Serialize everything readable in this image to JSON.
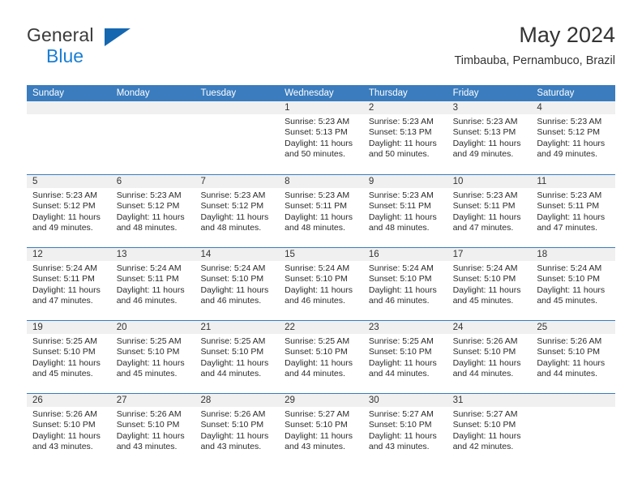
{
  "brand": {
    "name_part1": "General",
    "name_part2": "Blue",
    "triangle_color": "#1567b0",
    "blue_color": "#1a7fd4"
  },
  "header": {
    "title": "May 2024",
    "subtitle": "Timbauba, Pernambuco, Brazil"
  },
  "calendar": {
    "header_bg": "#3a7cbe",
    "daynum_bg": "#f0f0f0",
    "weekday_headers": [
      "Sunday",
      "Monday",
      "Tuesday",
      "Wednesday",
      "Thursday",
      "Friday",
      "Saturday"
    ],
    "weeks": [
      [
        {
          "day": "",
          "sunrise": "",
          "sunset": "",
          "daylight_line1": "",
          "daylight_line2": ""
        },
        {
          "day": "",
          "sunrise": "",
          "sunset": "",
          "daylight_line1": "",
          "daylight_line2": ""
        },
        {
          "day": "",
          "sunrise": "",
          "sunset": "",
          "daylight_line1": "",
          "daylight_line2": ""
        },
        {
          "day": "1",
          "sunrise": "Sunrise: 5:23 AM",
          "sunset": "Sunset: 5:13 PM",
          "daylight_line1": "Daylight: 11 hours",
          "daylight_line2": "and 50 minutes."
        },
        {
          "day": "2",
          "sunrise": "Sunrise: 5:23 AM",
          "sunset": "Sunset: 5:13 PM",
          "daylight_line1": "Daylight: 11 hours",
          "daylight_line2": "and 50 minutes."
        },
        {
          "day": "3",
          "sunrise": "Sunrise: 5:23 AM",
          "sunset": "Sunset: 5:13 PM",
          "daylight_line1": "Daylight: 11 hours",
          "daylight_line2": "and 49 minutes."
        },
        {
          "day": "4",
          "sunrise": "Sunrise: 5:23 AM",
          "sunset": "Sunset: 5:12 PM",
          "daylight_line1": "Daylight: 11 hours",
          "daylight_line2": "and 49 minutes."
        }
      ],
      [
        {
          "day": "5",
          "sunrise": "Sunrise: 5:23 AM",
          "sunset": "Sunset: 5:12 PM",
          "daylight_line1": "Daylight: 11 hours",
          "daylight_line2": "and 49 minutes."
        },
        {
          "day": "6",
          "sunrise": "Sunrise: 5:23 AM",
          "sunset": "Sunset: 5:12 PM",
          "daylight_line1": "Daylight: 11 hours",
          "daylight_line2": "and 48 minutes."
        },
        {
          "day": "7",
          "sunrise": "Sunrise: 5:23 AM",
          "sunset": "Sunset: 5:12 PM",
          "daylight_line1": "Daylight: 11 hours",
          "daylight_line2": "and 48 minutes."
        },
        {
          "day": "8",
          "sunrise": "Sunrise: 5:23 AM",
          "sunset": "Sunset: 5:11 PM",
          "daylight_line1": "Daylight: 11 hours",
          "daylight_line2": "and 48 minutes."
        },
        {
          "day": "9",
          "sunrise": "Sunrise: 5:23 AM",
          "sunset": "Sunset: 5:11 PM",
          "daylight_line1": "Daylight: 11 hours",
          "daylight_line2": "and 48 minutes."
        },
        {
          "day": "10",
          "sunrise": "Sunrise: 5:23 AM",
          "sunset": "Sunset: 5:11 PM",
          "daylight_line1": "Daylight: 11 hours",
          "daylight_line2": "and 47 minutes."
        },
        {
          "day": "11",
          "sunrise": "Sunrise: 5:23 AM",
          "sunset": "Sunset: 5:11 PM",
          "daylight_line1": "Daylight: 11 hours",
          "daylight_line2": "and 47 minutes."
        }
      ],
      [
        {
          "day": "12",
          "sunrise": "Sunrise: 5:24 AM",
          "sunset": "Sunset: 5:11 PM",
          "daylight_line1": "Daylight: 11 hours",
          "daylight_line2": "and 47 minutes."
        },
        {
          "day": "13",
          "sunrise": "Sunrise: 5:24 AM",
          "sunset": "Sunset: 5:11 PM",
          "daylight_line1": "Daylight: 11 hours",
          "daylight_line2": "and 46 minutes."
        },
        {
          "day": "14",
          "sunrise": "Sunrise: 5:24 AM",
          "sunset": "Sunset: 5:10 PM",
          "daylight_line1": "Daylight: 11 hours",
          "daylight_line2": "and 46 minutes."
        },
        {
          "day": "15",
          "sunrise": "Sunrise: 5:24 AM",
          "sunset": "Sunset: 5:10 PM",
          "daylight_line1": "Daylight: 11 hours",
          "daylight_line2": "and 46 minutes."
        },
        {
          "day": "16",
          "sunrise": "Sunrise: 5:24 AM",
          "sunset": "Sunset: 5:10 PM",
          "daylight_line1": "Daylight: 11 hours",
          "daylight_line2": "and 46 minutes."
        },
        {
          "day": "17",
          "sunrise": "Sunrise: 5:24 AM",
          "sunset": "Sunset: 5:10 PM",
          "daylight_line1": "Daylight: 11 hours",
          "daylight_line2": "and 45 minutes."
        },
        {
          "day": "18",
          "sunrise": "Sunrise: 5:24 AM",
          "sunset": "Sunset: 5:10 PM",
          "daylight_line1": "Daylight: 11 hours",
          "daylight_line2": "and 45 minutes."
        }
      ],
      [
        {
          "day": "19",
          "sunrise": "Sunrise: 5:25 AM",
          "sunset": "Sunset: 5:10 PM",
          "daylight_line1": "Daylight: 11 hours",
          "daylight_line2": "and 45 minutes."
        },
        {
          "day": "20",
          "sunrise": "Sunrise: 5:25 AM",
          "sunset": "Sunset: 5:10 PM",
          "daylight_line1": "Daylight: 11 hours",
          "daylight_line2": "and 45 minutes."
        },
        {
          "day": "21",
          "sunrise": "Sunrise: 5:25 AM",
          "sunset": "Sunset: 5:10 PM",
          "daylight_line1": "Daylight: 11 hours",
          "daylight_line2": "and 44 minutes."
        },
        {
          "day": "22",
          "sunrise": "Sunrise: 5:25 AM",
          "sunset": "Sunset: 5:10 PM",
          "daylight_line1": "Daylight: 11 hours",
          "daylight_line2": "and 44 minutes."
        },
        {
          "day": "23",
          "sunrise": "Sunrise: 5:25 AM",
          "sunset": "Sunset: 5:10 PM",
          "daylight_line1": "Daylight: 11 hours",
          "daylight_line2": "and 44 minutes."
        },
        {
          "day": "24",
          "sunrise": "Sunrise: 5:26 AM",
          "sunset": "Sunset: 5:10 PM",
          "daylight_line1": "Daylight: 11 hours",
          "daylight_line2": "and 44 minutes."
        },
        {
          "day": "25",
          "sunrise": "Sunrise: 5:26 AM",
          "sunset": "Sunset: 5:10 PM",
          "daylight_line1": "Daylight: 11 hours",
          "daylight_line2": "and 44 minutes."
        }
      ],
      [
        {
          "day": "26",
          "sunrise": "Sunrise: 5:26 AM",
          "sunset": "Sunset: 5:10 PM",
          "daylight_line1": "Daylight: 11 hours",
          "daylight_line2": "and 43 minutes."
        },
        {
          "day": "27",
          "sunrise": "Sunrise: 5:26 AM",
          "sunset": "Sunset: 5:10 PM",
          "daylight_line1": "Daylight: 11 hours",
          "daylight_line2": "and 43 minutes."
        },
        {
          "day": "28",
          "sunrise": "Sunrise: 5:26 AM",
          "sunset": "Sunset: 5:10 PM",
          "daylight_line1": "Daylight: 11 hours",
          "daylight_line2": "and 43 minutes."
        },
        {
          "day": "29",
          "sunrise": "Sunrise: 5:27 AM",
          "sunset": "Sunset: 5:10 PM",
          "daylight_line1": "Daylight: 11 hours",
          "daylight_line2": "and 43 minutes."
        },
        {
          "day": "30",
          "sunrise": "Sunrise: 5:27 AM",
          "sunset": "Sunset: 5:10 PM",
          "daylight_line1": "Daylight: 11 hours",
          "daylight_line2": "and 43 minutes."
        },
        {
          "day": "31",
          "sunrise": "Sunrise: 5:27 AM",
          "sunset": "Sunset: 5:10 PM",
          "daylight_line1": "Daylight: 11 hours",
          "daylight_line2": "and 42 minutes."
        },
        {
          "day": "",
          "sunrise": "",
          "sunset": "",
          "daylight_line1": "",
          "daylight_line2": ""
        }
      ]
    ]
  }
}
